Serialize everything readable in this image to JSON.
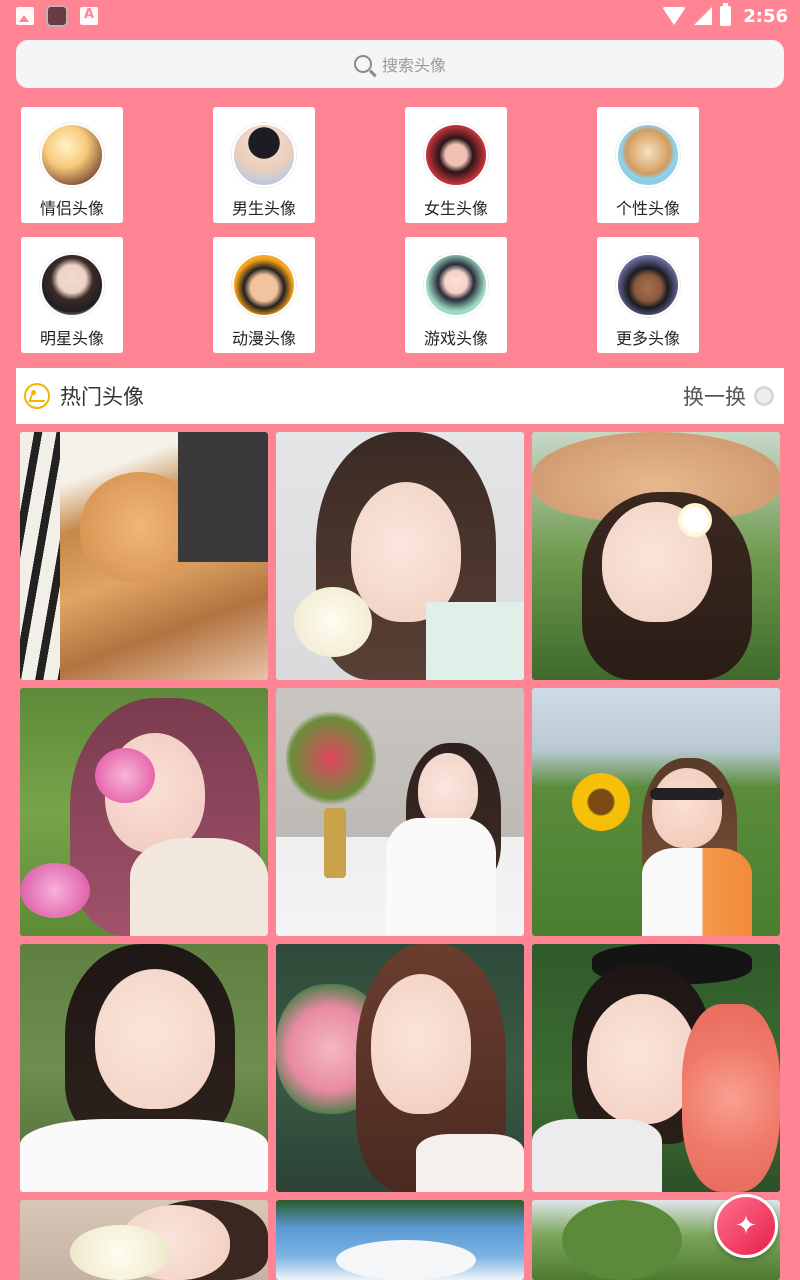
{
  "status_bar": {
    "time": "2:56",
    "icons": [
      "image-icon",
      "app-icon",
      "text-icon",
      "wifi-icon",
      "signal-icon",
      "battery-icon"
    ]
  },
  "search": {
    "placeholder": "搜索头像"
  },
  "categories": [
    {
      "label": "情侣头像",
      "icon": "couple-avatar"
    },
    {
      "label": "男生头像",
      "icon": "male-avatar"
    },
    {
      "label": "女生头像",
      "icon": "female-avatar"
    },
    {
      "label": "个性头像",
      "icon": "dog-avatar"
    },
    {
      "label": "明星头像",
      "icon": "star-avatar"
    },
    {
      "label": "动漫头像",
      "icon": "anime-avatar"
    },
    {
      "label": "游戏头像",
      "icon": "game-avatar"
    },
    {
      "label": "更多头像",
      "icon": "more-avatar"
    }
  ],
  "hot_section": {
    "title": "热门头像",
    "refresh_label": "换一换"
  },
  "photos": [
    "cat-photo",
    "girl-with-rose",
    "girl-with-straw-hat",
    "girl-with-cosmos-flowers",
    "girl-by-vase",
    "girl-with-sunflower",
    "girl-with-braids",
    "girl-with-pink-roses",
    "girl-with-bunny-ears",
    "girl-with-white-rose",
    "sky-trees",
    "trees-photo"
  ],
  "colors": {
    "background": "#ff8595",
    "accent": "#e8204a",
    "section_icon": "#f4b400"
  }
}
